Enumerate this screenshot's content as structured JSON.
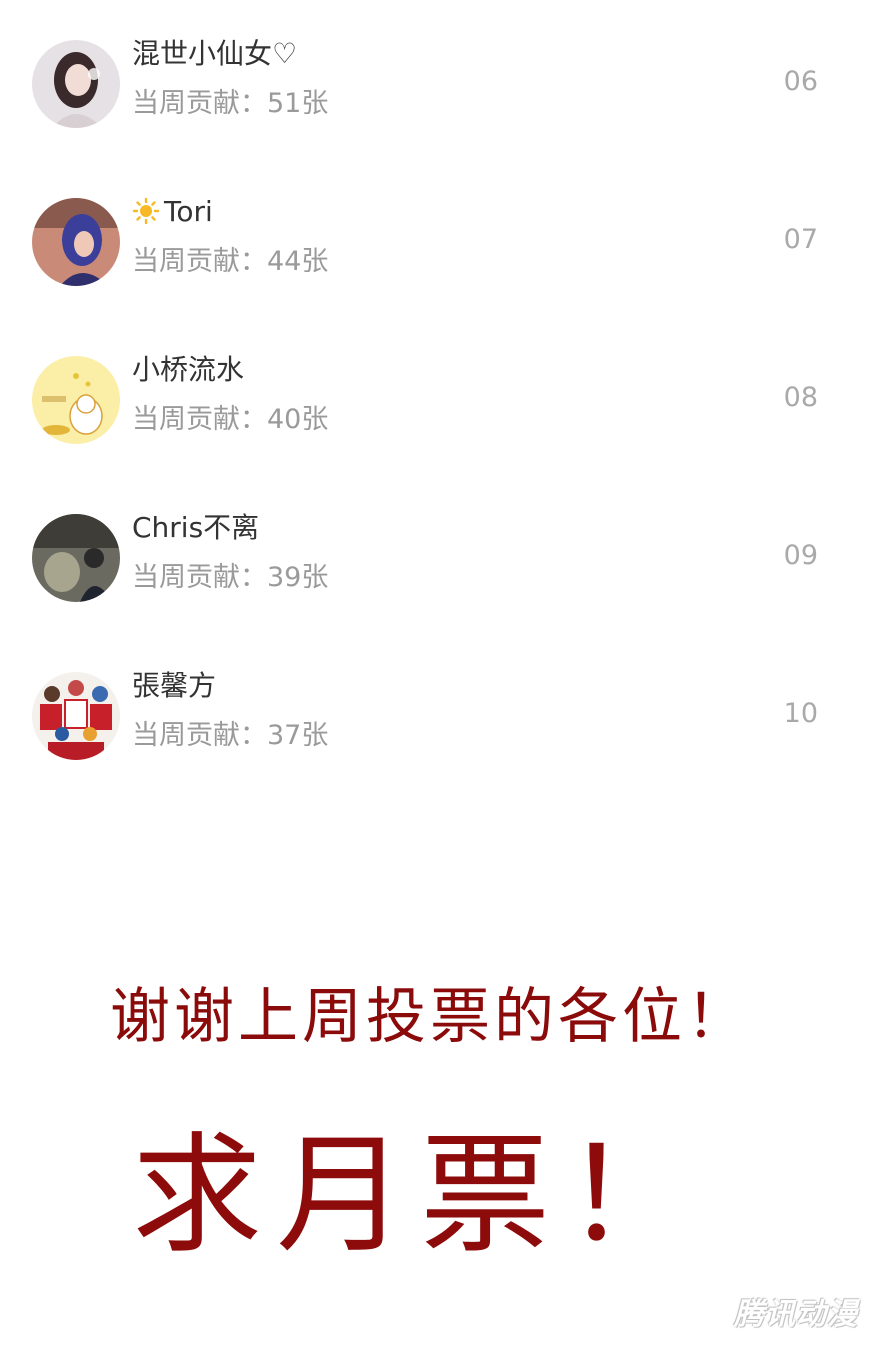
{
  "ranking": [
    {
      "name": "混世小仙女♡",
      "contribution": "当周贡献：51张",
      "rank": "06",
      "avatar": "girl-portrait"
    },
    {
      "name": "Tori",
      "name_icon": "sun-icon",
      "contribution": "当周贡献：44张",
      "rank": "07",
      "avatar": "blue-hair-cosplay"
    },
    {
      "name": "小桥流水",
      "contribution": "当周贡献：40张",
      "rank": "08",
      "avatar": "lucky-cat"
    },
    {
      "name": "Chris不离",
      "contribution": "当周贡献：39张",
      "rank": "09",
      "avatar": "indoor-photo"
    },
    {
      "name": "張馨方",
      "contribution": "当周贡献：37张",
      "rank": "10",
      "avatar": "basketball-anime-team"
    }
  ],
  "thanks_text": "谢谢上周投票的各位！",
  "beg_text": "求月票！",
  "watermark": "腾讯动漫",
  "colors": {
    "accent": "#8b0a0a",
    "name": "#333333",
    "muted": "#9a9a9a"
  }
}
